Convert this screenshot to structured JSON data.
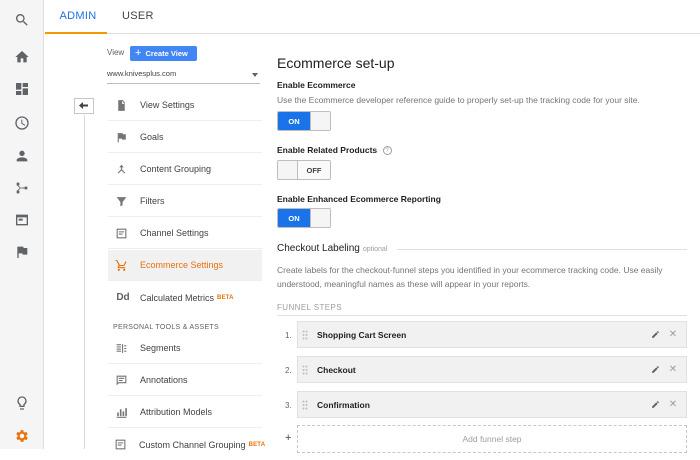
{
  "rail": {
    "items": [
      {
        "icon": "search-icon"
      },
      {
        "icon": "home-icon"
      },
      {
        "icon": "dashboard-icon"
      },
      {
        "icon": "clock-icon"
      },
      {
        "icon": "person-icon"
      },
      {
        "icon": "acquisition-icon"
      },
      {
        "icon": "behavior-icon"
      },
      {
        "icon": "flag-icon"
      },
      {
        "icon": "lightbulb-icon"
      },
      {
        "icon": "gear-icon"
      }
    ],
    "accent": "#e8710a"
  },
  "tabs": [
    {
      "label": "ADMIN",
      "active": true
    },
    {
      "label": "USER",
      "active": false
    }
  ],
  "view": {
    "label": "View",
    "create_label": "Create View",
    "selected": "www.knivesplus.com"
  },
  "nav": {
    "items": [
      {
        "label": "View Settings",
        "icon": "document-icon"
      },
      {
        "label": "Goals",
        "icon": "flag-icon"
      },
      {
        "label": "Content Grouping",
        "icon": "grouping-icon"
      },
      {
        "label": "Filters",
        "icon": "filter-icon"
      },
      {
        "label": "Channel Settings",
        "icon": "channel-icon"
      },
      {
        "label": "Ecommerce Settings",
        "icon": "cart-icon",
        "active": true
      },
      {
        "label": "Calculated Metrics",
        "icon": "dd-icon",
        "badge": "BETA"
      }
    ],
    "section_label": "PERSONAL TOOLS & ASSETS",
    "personal": [
      {
        "label": "Segments",
        "icon": "segments-icon"
      },
      {
        "label": "Annotations",
        "icon": "annotation-icon"
      },
      {
        "label": "Attribution Models",
        "icon": "bars-icon"
      },
      {
        "label": "Custom Channel Grouping",
        "icon": "channel-icon",
        "badge": "BETA"
      }
    ]
  },
  "main": {
    "title": "Ecommerce set-up",
    "enable_ecommerce": {
      "label": "Enable Ecommerce",
      "description": "Use the Ecommerce developer reference guide to properly set-up the tracking code for your site.",
      "state": "ON"
    },
    "related_products": {
      "label": "Enable Related Products",
      "help": "?",
      "state": "OFF"
    },
    "enhanced": {
      "label": "Enable Enhanced Ecommerce Reporting",
      "state": "ON"
    },
    "checkout": {
      "title": "Checkout Labeling",
      "optional": "optional",
      "description": "Create labels for the checkout-funnel steps you identified in your ecommerce tracking code. Use easily understood, meaningful names as these will appear in your reports."
    },
    "funnel": {
      "heading": "FUNNEL STEPS",
      "steps": [
        {
          "num": "1.",
          "name": "Shopping Cart Screen"
        },
        {
          "num": "2.",
          "name": "Checkout"
        },
        {
          "num": "3.",
          "name": "Confirmation"
        }
      ],
      "add_plus": "+",
      "add_label": "Add funnel step"
    }
  }
}
